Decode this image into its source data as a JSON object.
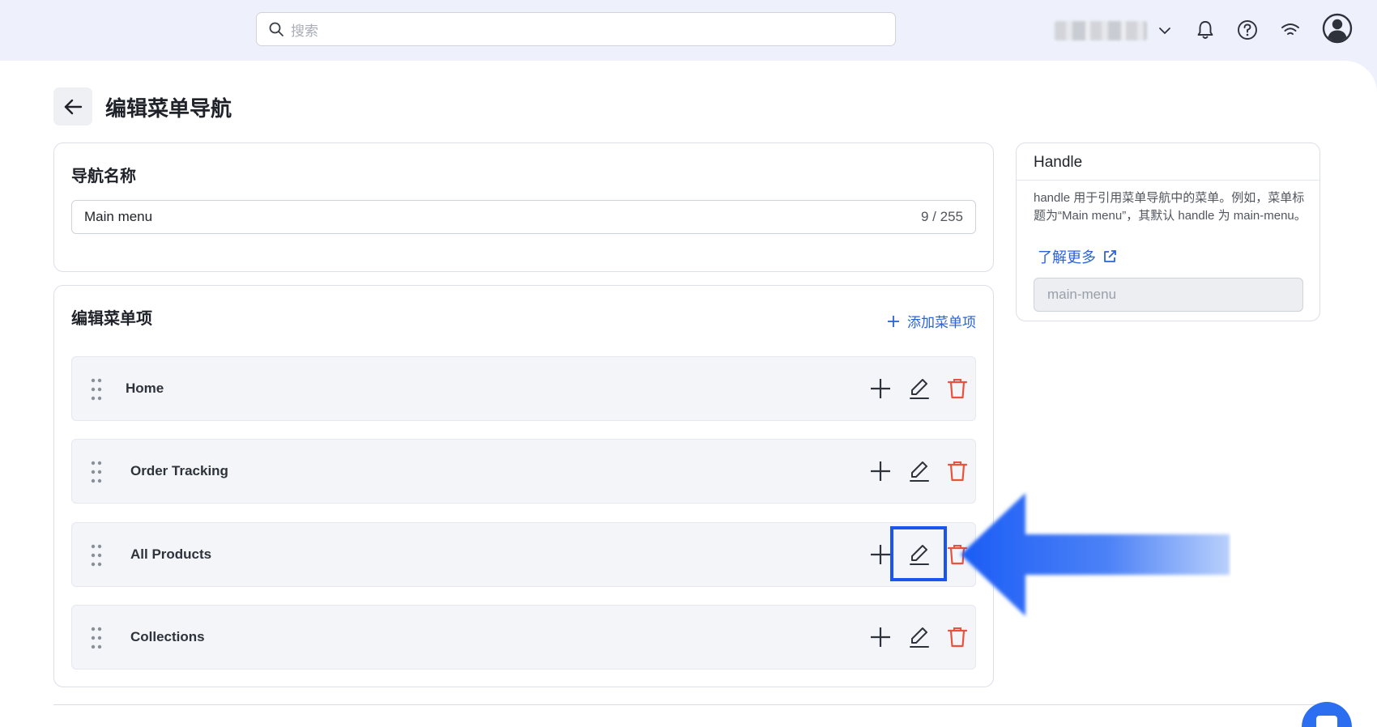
{
  "header": {
    "search_placeholder": "搜索",
    "icons": [
      "search-icon",
      "chevron-down-icon",
      "bell-icon",
      "help-icon",
      "wifi-icon",
      "avatar-icon"
    ]
  },
  "page": {
    "title": "编辑菜单导航"
  },
  "nav_name_card": {
    "title": "导航名称",
    "input_value": "Main menu",
    "counter": "9 / 255"
  },
  "menu_items_card": {
    "title": "编辑菜单项",
    "add_label": "添加菜单项",
    "items": [
      {
        "label": "Home"
      },
      {
        "label": "Order Tracking"
      },
      {
        "label": "All Products"
      },
      {
        "label": "Collections"
      }
    ]
  },
  "handle_card": {
    "title": "Handle",
    "description": "handle 用于引用菜单导航中的菜单。例如，菜单标题为“Main menu”，其默认 handle 为 main-menu。",
    "learn_more": "了解更多",
    "value": "main-menu"
  },
  "colors": {
    "accent": "#2b63d9",
    "danger": "#e8533f",
    "highlight": "#1a55f0"
  }
}
